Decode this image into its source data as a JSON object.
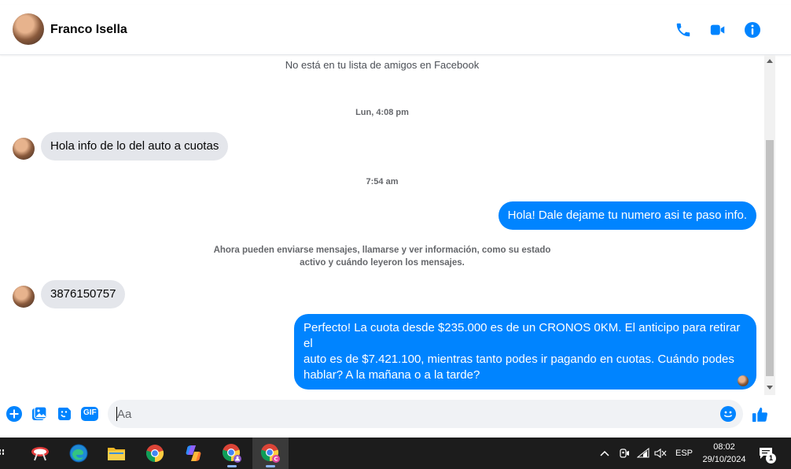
{
  "header": {
    "contact_name": "Franco Isella",
    "icons": [
      "phone-icon",
      "video-camera-icon",
      "info-icon"
    ]
  },
  "thread": {
    "not_friends_notice": "No está en tu lista de amigos en Facebook",
    "timestamp_1": "Lun, 4:08 pm",
    "msg_in_1": "Hola info de lo del auto a cuotas",
    "timestamp_2": "7:54 am",
    "msg_out_1": "Hola! Dale dejame tu numero  asi te paso info.",
    "notice_line_1": "Ahora pueden enviarse mensajes, llamarse y ver información, como su estado",
    "notice_line_2": "activo y cuándo leyeron los mensajes.",
    "msg_in_2": "3876150757",
    "msg_out_2_line_1": "Perfecto! La cuota desde $235.000 es de un CRONOS 0KM. El anticipo para retirar el",
    "msg_out_2_line_2": "auto es de $7.421.100, mientras tanto podes ir pagando en cuotas. Cuándo podes",
    "msg_out_2_line_3": "hablar? A la mañana o a la tarde?"
  },
  "composer": {
    "placeholder": "Aa",
    "icons": [
      "plus-icon",
      "photo-icon",
      "sticker-icon",
      "gif-icon",
      "emoji-icon",
      "thumbs-up-icon"
    ],
    "gif_label": "GIF"
  },
  "taskbar": {
    "language": "ESP",
    "time": "08:02",
    "date": "29/10/2024",
    "notification_count": "1"
  },
  "colors": {
    "accent": "#0084ff",
    "incoming_bubble": "#e4e6eb",
    "taskbar": "#1c1c1c"
  }
}
